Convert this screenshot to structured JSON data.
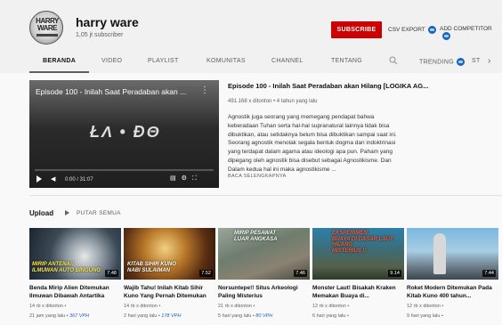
{
  "channel": {
    "name": "harry ware",
    "subscribers": "1,05 jt subscriber",
    "avatar_text": "HARRY WARE"
  },
  "actions": {
    "subscribe": "SUBSCRIBE",
    "csv_export": "CSV EXPORT",
    "add_competitor": "ADD COMPETITOR"
  },
  "tabs": [
    "BERANDA",
    "VIDEO",
    "PLAYLIST",
    "KOMUNITAS",
    "CHANNEL",
    "TENTANG",
    "TRENDING",
    "ST"
  ],
  "featured": {
    "player_title": "Episode 100 - Inilah Saat Peradaban akan ...",
    "player_logo": "ŁΛ • ĐΘ",
    "time": "0:00 / 31:07",
    "title": "Episode 100 - Inilah Saat Peradaban akan Hilang [LOGIKA AG...",
    "meta": "491.168 x ditonton • 4 tahun yang lalu",
    "description": "Agnostik juga seorang yang memegang pendapat bahwa keberadaan Tuhan serta hal-hal supranatural lainnya tidak bisa dibuktikan, atau setidaknya belum bisa dibuktikan sampai saat ini. Seorang agnostik menolak segala bentuk dogma dan indoktrinasi yang terdapat dalam agama atau ideologi apa pun. Paham yang dipegang oleh agnostik bisa disebut sebagai Agnostikisme.  Dan Dalam kedua hal ini maka agnostikisme ...",
    "read_more": "BACA SELENGKAPNYA"
  },
  "uploads": {
    "title": "Upload",
    "play_all": "PUTAR SEMUA",
    "videos": [
      {
        "title": "Benda Mirip Alien Ditemukan Ilmuwan Dibawah Antartika",
        "views": "14 rb x ditonton •",
        "age": "21 jam yang lalu • ",
        "vph": "367 VPH",
        "duration": "7.48",
        "overlay": "MIRIP ANTENA!!\nILMUWAN AUTO BINGUNG"
      },
      {
        "title": "Wajib Tahu! Inilah Kitab Sihir Kuno Yang Pernah Ditemukan",
        "views": "14 rb x ditonton •",
        "age": "2 hari yang lalu • ",
        "vph": "178 VPH",
        "duration": "7.52",
        "overlay": "KITAB SIHIR KUNO\nNABI SULAIMAN"
      },
      {
        "title": "Norsuntepe!! Situs Arkeologi Paling Misterius",
        "views": "21 rb x ditonton •",
        "age": "5 hari yang lalu • ",
        "vph": "80 VPH",
        "duration": "7.46",
        "overlay": "MIRIP PESAWAT\nLUAR ANGKASA"
      },
      {
        "title": "Monster Laut! Bisakah Kraken Memakan Buaya di...",
        "views": "12 rb x ditonton •",
        "age": "6 hari yang lalu •",
        "vph": "",
        "duration": "9.14",
        "overlay": "EKSPERIMEN:\nBUAYA DI DASAR LAUT\nHILANG\nMISTERIUS !!"
      },
      {
        "title": "Roket Modern Ditemukan Pada Kitab Kuno 400 tahun...",
        "views": "12 rb x ditonton •",
        "age": "9 hari yang lalu •",
        "vph": "",
        "duration": "7.44",
        "overlay": ""
      }
    ]
  },
  "colors": {
    "subscribe_red": "#cc0000",
    "vph_blue": "#1c62b9",
    "header_bg": "#f1f1f1"
  }
}
